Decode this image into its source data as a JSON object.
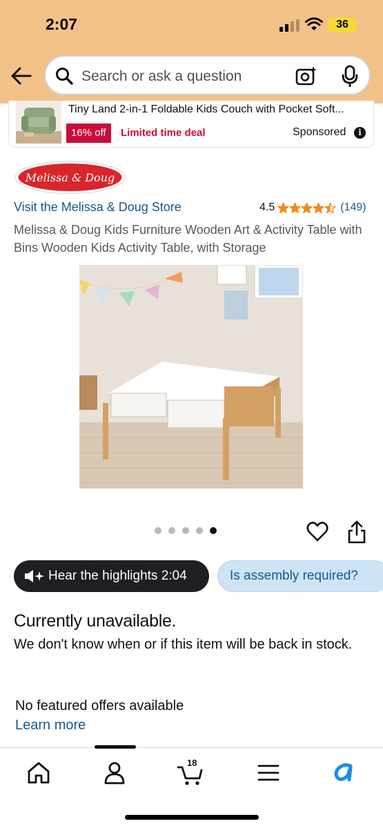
{
  "status_bar": {
    "time": "2:07",
    "battery": "36"
  },
  "search": {
    "placeholder": "Search or ask a question"
  },
  "sponsored_ad": {
    "title": "Tiny Land 2-in-1 Foldable Kids Couch with Pocket Soft...",
    "discount": "16% off",
    "deal_label": "Limited time deal",
    "sponsored_label": "Sponsored",
    "info_icon": "i"
  },
  "brand": {
    "logo_text": "Melissa & Doug"
  },
  "product": {
    "store_link": "Visit the Melissa & Doug Store",
    "rating": "4.5",
    "rating_value": 4.5,
    "review_count": "(149)",
    "title": "Melissa & Doug Kids Furniture Wooden Art & Activity Table with Bins Wooden Kids Activity Table, with Storage"
  },
  "carousel": {
    "total": 5,
    "active_index": 4
  },
  "actions": {
    "hear_highlights": "Hear the highlights 2:04",
    "assembly_question": "Is assembly required?"
  },
  "availability": {
    "status": "Currently unavailable.",
    "description": "We don't know when or if this item will be back in stock.",
    "offers": "No featured offers available",
    "learn_more": "Learn more"
  },
  "bottom_nav": {
    "items": [
      "home-icon",
      "account-icon",
      "cart-icon",
      "menu-icon",
      "rufus-icon"
    ],
    "cart_count": "18"
  },
  "colors": {
    "header_bg": "#f3c288",
    "link": "#16588e",
    "deal_red": "#cc0c39",
    "star": "#f08c1c",
    "chip_blue": "#cfe3f7"
  }
}
